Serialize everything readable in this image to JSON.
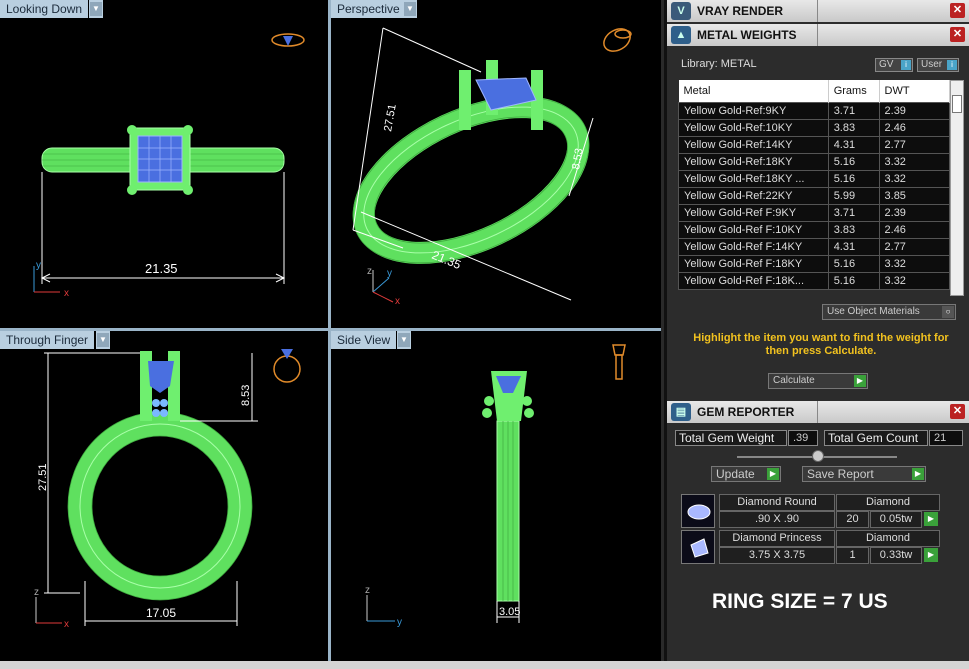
{
  "viewports": {
    "top_left": {
      "label": "Looking Down",
      "dimension": "21.35",
      "axis1": "y",
      "axis2": "x"
    },
    "top_right": {
      "label": "Perspective",
      "dim_height": "27.51",
      "dim_head": "8.53",
      "dim_width": "21.35",
      "axis1": "z",
      "axis2": "y",
      "axis3": "x"
    },
    "bottom_left": {
      "label": "Through Finger",
      "dim_height": "27.51",
      "dim_head": "8.53",
      "dim_width": "17.05",
      "axis1": "z",
      "axis2": "x"
    },
    "bottom_right": {
      "label": "Side View",
      "dim_band": "3.05",
      "axis1": "z",
      "axis2": "y"
    }
  },
  "vray": {
    "title": "VRAY RENDER"
  },
  "metal_weights": {
    "title": "METAL WEIGHTS",
    "library": "Library: METAL",
    "toggle_gv": "GV",
    "toggle_user": "User",
    "columns": [
      "Metal",
      "Grams",
      "DWT"
    ],
    "rows": [
      [
        "Yellow Gold-Ref:9KY",
        "3.71",
        "2.39"
      ],
      [
        "Yellow Gold-Ref:10KY",
        "3.83",
        "2.46"
      ],
      [
        "Yellow Gold-Ref:14KY",
        "4.31",
        "2.77"
      ],
      [
        "Yellow Gold-Ref:18KY",
        "5.16",
        "3.32"
      ],
      [
        "Yellow Gold-Ref:18KY ...",
        "5.16",
        "3.32"
      ],
      [
        "Yellow Gold-Ref:22KY",
        "5.99",
        "3.85"
      ],
      [
        "Yellow Gold-Ref F:9KY",
        "3.71",
        "2.39"
      ],
      [
        "Yellow Gold-Ref F:10KY",
        "3.83",
        "2.46"
      ],
      [
        "Yellow Gold-Ref F:14KY",
        "4.31",
        "2.77"
      ],
      [
        "Yellow Gold-Ref F:18KY",
        "5.16",
        "3.32"
      ],
      [
        "Yellow Gold-Ref F:18K...",
        "5.16",
        "3.32"
      ]
    ],
    "use_object_materials": "Use Object Materials",
    "hint": "Highlight the item you want to find the weight for then press Calculate.",
    "calculate": "Calculate"
  },
  "gem_reporter": {
    "title": "GEM REPORTER",
    "total_weight_label": "Total Gem Weight",
    "total_weight_value": ".39",
    "total_count_label": "Total Gem Count",
    "total_count_value": "21",
    "update": "Update",
    "save_report": "Save Report",
    "gems": [
      {
        "name": "Diamond Round",
        "type": "Diamond",
        "size": ".90 X .90",
        "count": "20",
        "weight": "0.05tw"
      },
      {
        "name": "Diamond Princess",
        "type": "Diamond",
        "size": "3.75 X 3.75",
        "count": "1",
        "weight": "0.33tw"
      }
    ]
  },
  "overlay": {
    "ring_size": "RING SIZE = 7 US"
  },
  "colors": {
    "ring": "#7dff7d",
    "stone": "#4a6fe0",
    "hint": "#f2c21f",
    "axis_x": "#e03a3a",
    "axis_y": "#3a9ad9"
  }
}
